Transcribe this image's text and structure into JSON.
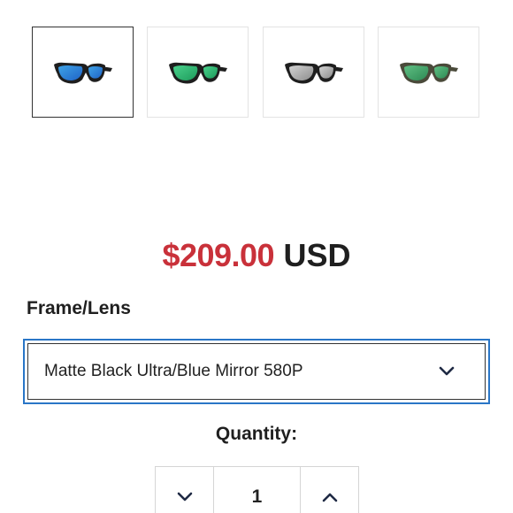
{
  "thumbnails": [
    {
      "name": "matte-black-blue-mirror",
      "frame_color": "#1e1e1e",
      "lens_color": "#1f63c8",
      "lens_highlight": "#3ea3e6",
      "selected": true
    },
    {
      "name": "black-green-mirror",
      "frame_color": "#1e1e1e",
      "lens_color": "#1d9b5b",
      "lens_highlight": "#49d08b",
      "selected": false
    },
    {
      "name": "black-silver-mirror",
      "frame_color": "#1e1e1e",
      "lens_color": "#8d8d8d",
      "lens_highlight": "#d2d2d2",
      "selected": false
    },
    {
      "name": "tortoise-green-mirror",
      "frame_color": "#4a4a3a",
      "lens_color": "#2d8a54",
      "lens_highlight": "#5fbf83",
      "selected": false
    }
  ],
  "price": {
    "amount": "$209.00",
    "currency": "USD",
    "amount_color": "#c9313a"
  },
  "frame_lens": {
    "label": "Frame/Lens",
    "selected_value": "Matte Black Ultra/Blue Mirror 580P",
    "focus_color": "#2a76c7"
  },
  "quantity": {
    "label": "Quantity:",
    "value": "1"
  },
  "icons": {
    "select": "chevron-down-icon",
    "decrement": "chevron-down-icon",
    "increment": "chevron-up-icon"
  }
}
